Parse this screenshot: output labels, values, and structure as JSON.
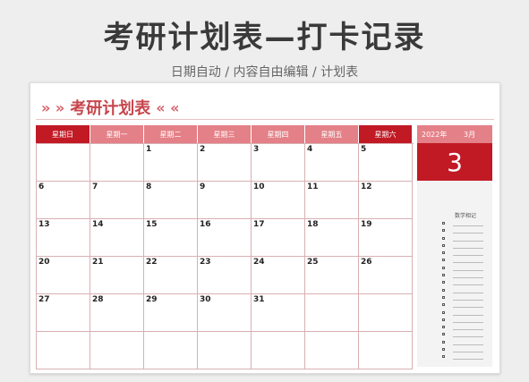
{
  "page": {
    "main_title": "考研计划表—打卡记录",
    "subtitle": "日期自动 / 内容自由编辑 / 计划表"
  },
  "sheet": {
    "deco_left": "» »",
    "title": "考研计划表",
    "deco_right": "« «"
  },
  "calendar": {
    "weekdays": [
      "星期日",
      "星期一",
      "星期二",
      "星期三",
      "星期四",
      "星期五",
      "星期六"
    ],
    "weeks": [
      [
        "",
        "",
        "1",
        "2",
        "3",
        "4",
        "5"
      ],
      [
        "6",
        "7",
        "8",
        "9",
        "10",
        "11",
        "12"
      ],
      [
        "13",
        "14",
        "15",
        "16",
        "17",
        "18",
        "19"
      ],
      [
        "20",
        "21",
        "22",
        "23",
        "24",
        "25",
        "26"
      ],
      [
        "27",
        "28",
        "29",
        "30",
        "31",
        "",
        ""
      ],
      [
        "",
        "",
        "",
        "",
        "",
        "",
        ""
      ]
    ]
  },
  "side": {
    "year": "2022年",
    "month": "3月",
    "day": "3",
    "notes_title": "数学相记"
  },
  "colors": {
    "accent_dark": "#c11a24",
    "accent_light": "#e48087",
    "title_red": "#c7454c"
  }
}
